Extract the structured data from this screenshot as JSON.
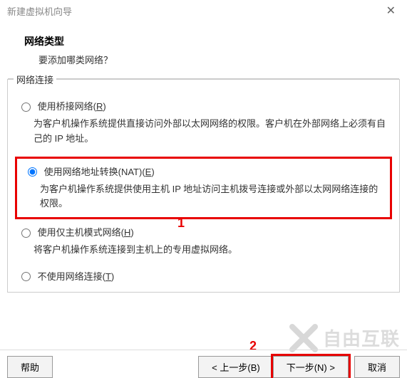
{
  "window": {
    "title": "新建虚拟机向导",
    "close": "✕"
  },
  "header": {
    "title": "网络类型",
    "subtitle": "要添加哪类网络？"
  },
  "group": {
    "legend": "网络连接",
    "options": [
      {
        "label": "使用桥接网络(",
        "key": "R",
        "suffix": ")",
        "desc": "为客户机操作系统提供直接访问外部以太网网络的权限。客户机在外部网络上必须有自己的 IP 地址。"
      },
      {
        "label": "使用网络地址转换(NAT)(",
        "key": "E",
        "suffix": ")",
        "desc": "为客户机操作系统提供使用主机 IP 地址访问主机拨号连接或外部以太网网络连接的权限。"
      },
      {
        "label": "使用仅主机模式网络(",
        "key": "H",
        "suffix": ")",
        "desc": "将客户机操作系统连接到主机上的专用虚拟网络。"
      },
      {
        "label": "不使用网络连接(",
        "key": "T",
        "suffix": ")",
        "desc": ""
      }
    ]
  },
  "annotations": {
    "a1": "1",
    "a2": "2"
  },
  "footer": {
    "help": "帮助",
    "back": "< 上一步(B)",
    "next": "下一步(N) >",
    "cancel": "取消"
  },
  "watermark": "自由互联"
}
